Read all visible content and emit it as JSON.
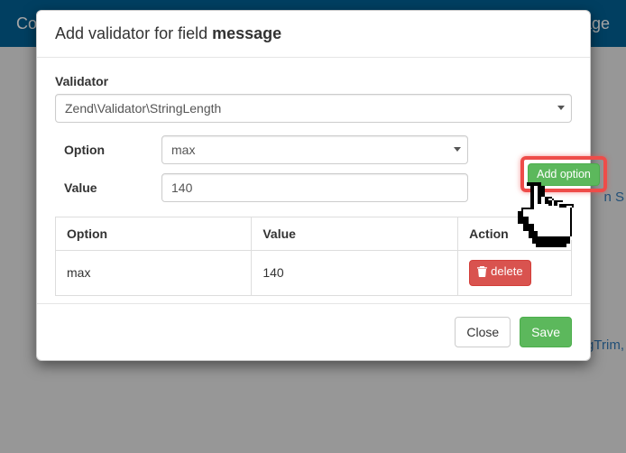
{
  "topbar": {
    "left_fragment": "Cor",
    "right_fragment": "ackage"
  },
  "background_links": {
    "link1": "n      S",
    "link2": "ingTrim,"
  },
  "modal": {
    "title_prefix": "Add validator for field ",
    "title_field": "message",
    "validator_label": "Validator",
    "validator_value": "Zend\\Validator\\StringLength",
    "option_label": "Option",
    "option_value": "max",
    "value_label": "Value",
    "value_value": "140",
    "add_option_label": "Add option",
    "table": {
      "headers": {
        "option": "Option",
        "value": "Value",
        "action": "Action"
      },
      "rows": [
        {
          "option": "max",
          "value": "140",
          "delete_label": "delete"
        }
      ]
    },
    "footer": {
      "close": "Close",
      "save": "Save"
    }
  }
}
